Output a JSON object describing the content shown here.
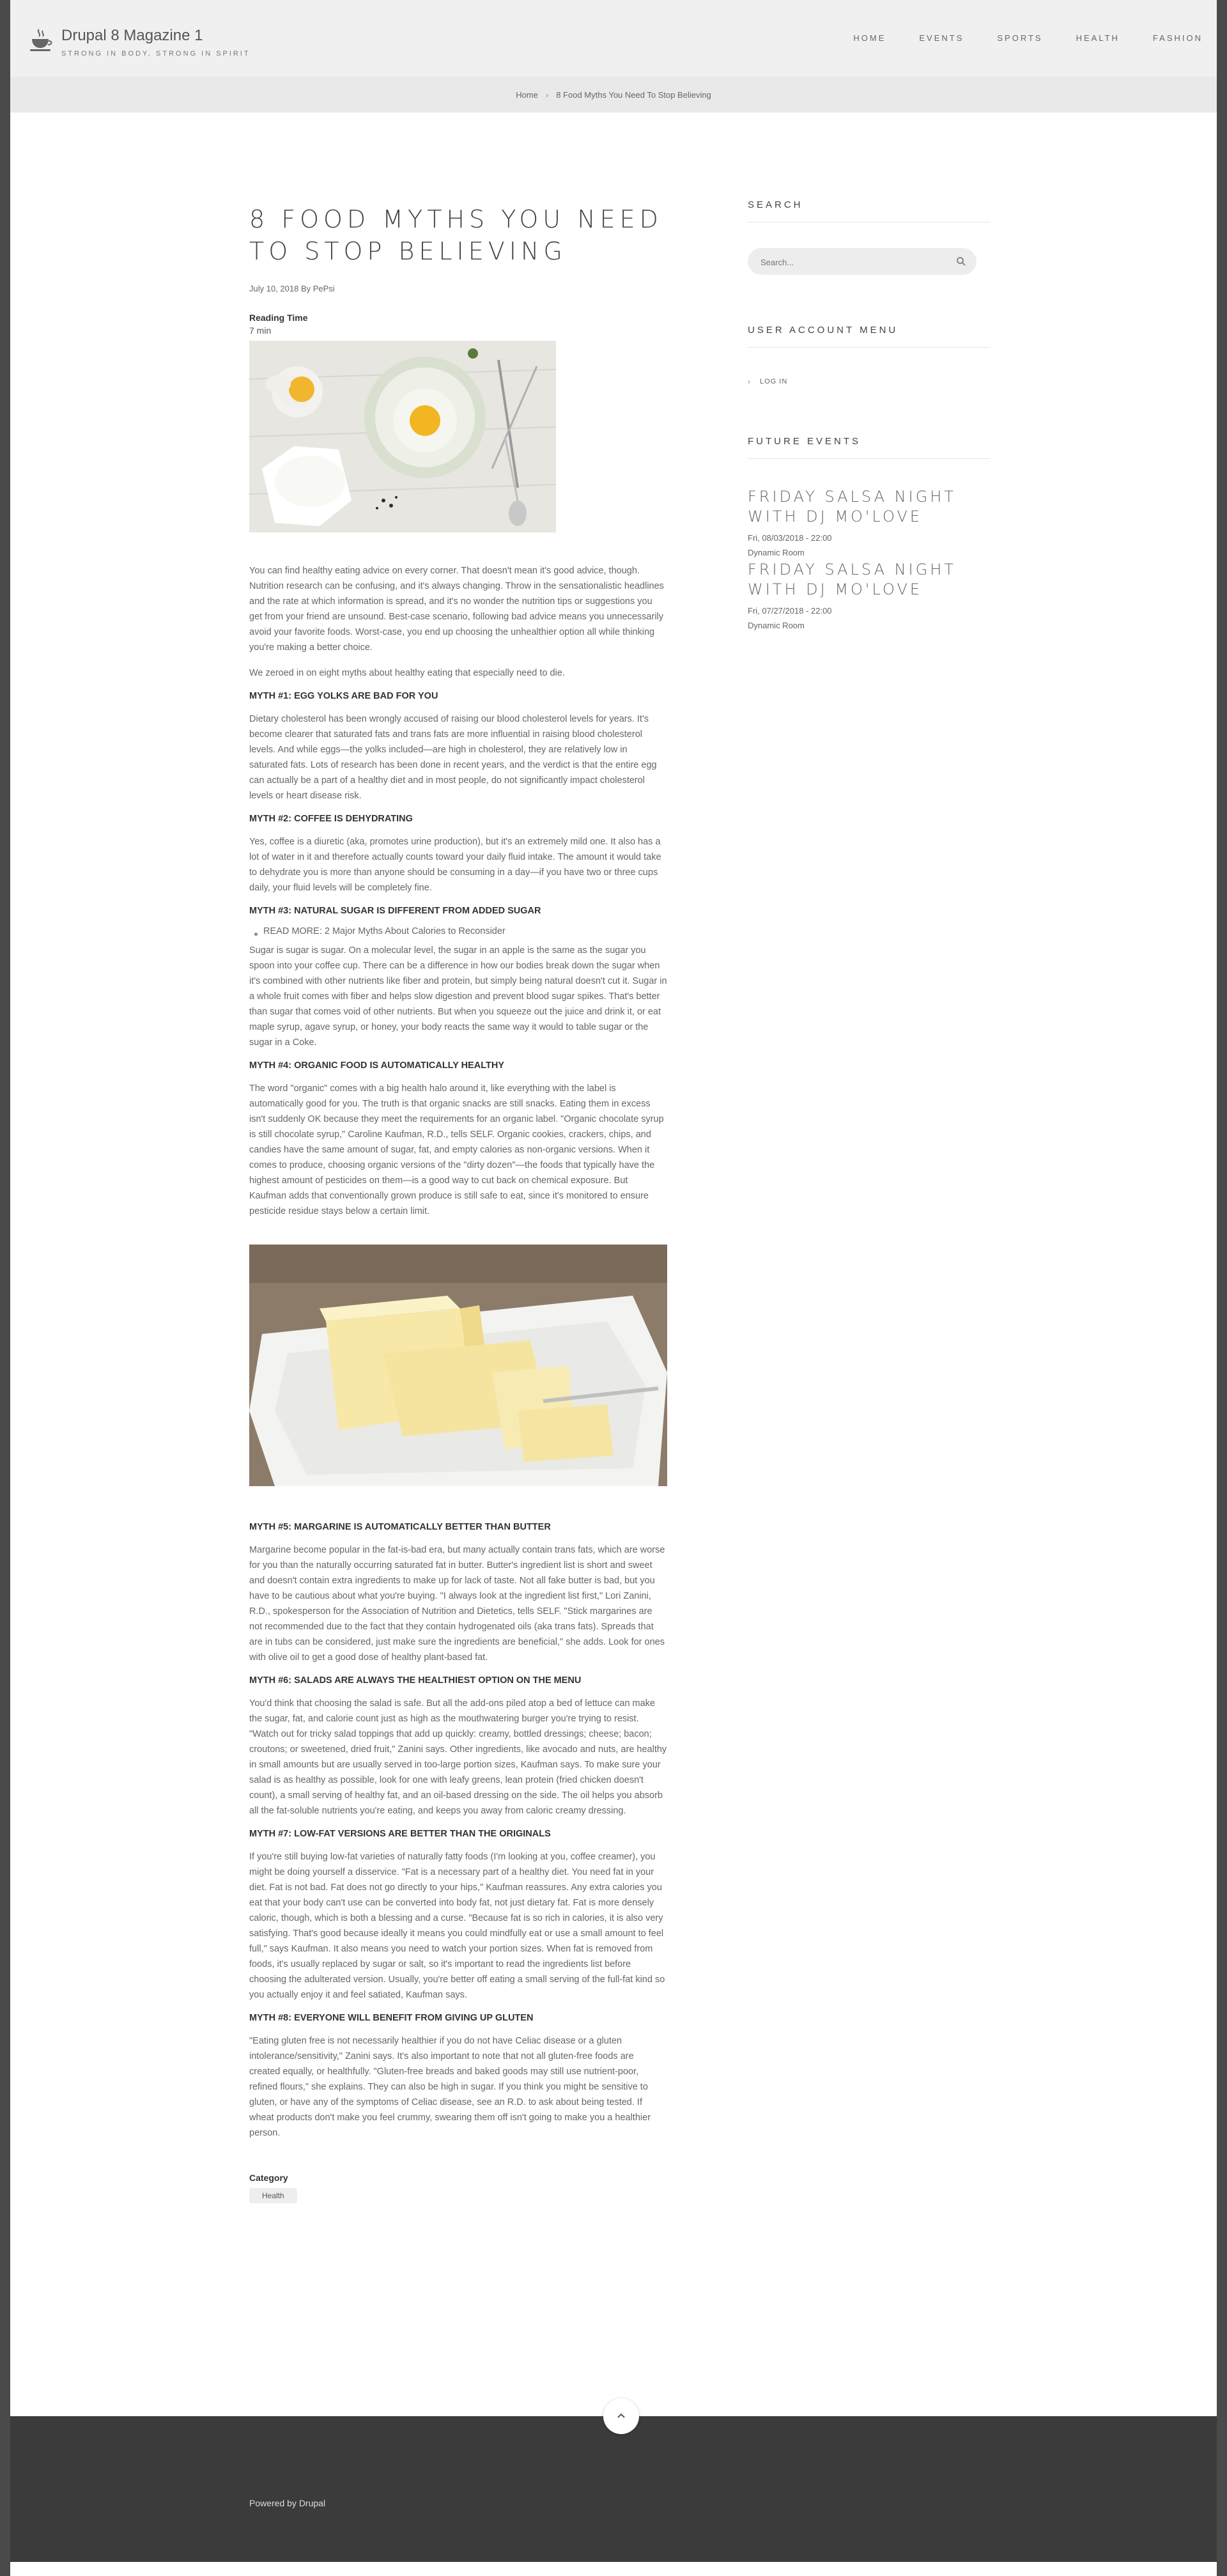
{
  "header": {
    "site_name": "Drupal 8 Magazine 1",
    "slogan": "STRONG IN BODY, STRONG IN SPIRIT",
    "nav": [
      "HOME",
      "EVENTS",
      "SPORTS",
      "HEALTH",
      "FASHION"
    ]
  },
  "breadcrumb": {
    "home": "Home",
    "current": "8 Food Myths You Need To Stop Believing"
  },
  "article": {
    "title": "8 FOOD MYTHS YOU NEED TO STOP BELIEVING",
    "meta": "July 10, 2018 By PePsi",
    "reading_time_label": "Reading Time",
    "reading_time_value": "7 min",
    "intro1": "You can find healthy eating advice on every corner. That doesn't mean it's good advice, though. Nutrition research can be confusing, and it's always changing. Throw in the sensationalistic headlines and the rate at which information is spread, and it's no wonder the nutrition tips or suggestions you get from your friend are unsound. Best-case scenario, following bad advice means you unnecessarily avoid your favorite foods. Worst-case, you end up choosing the unhealthier option all while thinking you're making a better choice.",
    "intro2": "We zeroed in on eight myths about healthy eating that especially need to die.",
    "myth1_title": "MYTH #1: EGG YOLKS ARE BAD FOR YOU",
    "myth1_text": "Dietary cholesterol has been wrongly accused of raising our blood cholesterol levels for years. It's become clearer that saturated fats and trans fats are more influential in raising blood cholesterol levels. And while eggs—the yolks included—are high in cholesterol, they are relatively low in saturated fats. Lots of research has been done in recent years, and the verdict is that the entire egg can actually be a part of a healthy diet and in most people, do not significantly impact cholesterol levels or heart disease risk.",
    "myth2_title": "MYTH #2: COFFEE IS DEHYDRATING",
    "myth2_text": "Yes, coffee is a diuretic (aka, promotes urine production), but it's an extremely mild one. It also has a lot of water in it and therefore actually counts toward your daily fluid intake. The amount it would take to dehydrate you is more than anyone should be consuming in a day—if you have two or three cups daily, your fluid levels will be completely fine.",
    "myth3_title": "MYTH #3: NATURAL SUGAR IS DIFFERENT FROM ADDED SUGAR",
    "myth3_readmore": "READ MORE: 2 Major Myths About Calories to Reconsider",
    "myth3_text": "Sugar is sugar is sugar. On a molecular level, the sugar in an apple is the same as the sugar you spoon into your coffee cup. There can be a difference in how our bodies break down the sugar when it's combined with other nutrients like fiber and protein, but simply being natural doesn't cut it. Sugar in a whole fruit comes with fiber and helps slow digestion and prevent blood sugar spikes. That's better than sugar that comes void of other nutrients. But when you squeeze out the juice and drink it, or eat maple syrup, agave syrup, or honey, your body reacts the same way it would to table sugar or the sugar in a Coke.",
    "myth4_title": "MYTH #4: ORGANIC FOOD IS AUTOMATICALLY HEALTHY",
    "myth4_text": "The word \"organic\" comes with a big health halo around it, like everything with the label is automatically good for you. The truth is that organic snacks are still snacks. Eating them in excess isn't suddenly OK because they meet the requirements for an organic label. \"Organic chocolate syrup is still chocolate syrup,\" Caroline Kaufman, R.D., tells SELF. Organic cookies, crackers, chips, and candies have the same amount of sugar, fat, and empty calories as non-organic versions. When it comes to produce, choosing organic versions of the \"dirty dozen\"—the foods that typically have the highest amount of pesticides on them—is a good way to cut back on chemical exposure. But Kaufman adds that conventionally grown produce is still safe to eat, since it's monitored to ensure pesticide residue stays below a certain limit.",
    "myth5_title": "MYTH #5: MARGARINE IS AUTOMATICALLY BETTER THAN BUTTER",
    "myth5_text": "Margarine become popular in the fat-is-bad era, but many actually contain trans fats, which are worse for you than the naturally occurring saturated fat in butter. Butter's ingredient list is short and sweet and doesn't contain extra ingredients to make up for lack of taste. Not all fake butter is bad, but you have to be cautious about what you're buying. \"I always look at the ingredient list first,\" Lori Zanini, R.D., spokesperson for the Association of Nutrition and Dietetics, tells SELF. \"Stick margarines are not recommended due to the fact that they contain hydrogenated oils (aka trans fats). Spreads that are in tubs can be considered, just make sure the ingredients are beneficial,\" she adds. Look for ones with olive oil to get a good dose of healthy plant-based fat.",
    "myth6_title": "MYTH #6: SALADS ARE ALWAYS THE HEALTHIEST OPTION ON THE MENU",
    "myth6_text": "You'd think that choosing the salad is safe. But all the add-ons piled atop a bed of lettuce can make the sugar, fat, and calorie count just as high as the mouthwatering burger you're trying to resist. \"Watch out for tricky salad toppings that add up quickly: creamy, bottled dressings; cheese; bacon; croutons; or sweetened, dried fruit,\" Zanini says. Other ingredients, like avocado and nuts, are healthy in small amounts but are usually served in too-large portion sizes, Kaufman says. To make sure your salad is as healthy as possible, look for one with leafy greens, lean protein (fried chicken doesn't count), a small serving of healthy fat, and an oil-based dressing on the side. The oil helps you absorb all the fat-soluble nutrients you're eating, and keeps you away from caloric creamy dressing.",
    "myth7_title": "MYTH #7: LOW-FAT VERSIONS ARE BETTER THAN THE ORIGINALS",
    "myth7_text": "If you're still buying low-fat varieties of naturally fatty foods (I'm looking at you, coffee creamer), you might be doing yourself a disservice. \"Fat is a necessary part of a healthy diet. You need fat in your diet. Fat is not bad. Fat does not go directly to your hips,\" Kaufman reassures. Any extra calories you eat that your body can't use can be converted into body fat, not just dietary fat. Fat is more densely caloric, though, which is both a blessing and a curse. \"Because fat is so rich in calories, it is also very satisfying. That's good because ideally it means you could mindfully eat or use a small amount to feel full,\" says Kaufman. It also means you need to watch your portion sizes. When fat is removed from foods, it's usually replaced by sugar or salt, so it's important to read the ingredients list before choosing the adulterated version. Usually, you're better off eating a small serving of the full-fat kind so you actually enjoy it and feel satiated, Kaufman says.",
    "myth8_title": "MYTH #8: EVERYONE WILL BENEFIT FROM GIVING UP GLUTEN",
    "myth8_text": "\"Eating gluten free is not necessarily healthier if you do not have Celiac disease or a gluten intolerance/sensitivity,\" Zanini says. It's also important to note that not all gluten-free foods are created equally, or healthfully. \"Gluten-free breads and baked goods may still use nutrient-poor, refined flours,\" she explains. They can also be high in sugar. If you think you might be sensitive to gluten, or have any of the symptoms of Celiac disease, see an R.D. to ask about being tested. If wheat products don't make you feel crummy, swearing them off isn't going to make you a healthier person.",
    "category_label": "Category",
    "category_value": "Health"
  },
  "sidebar": {
    "search_title": "SEARCH",
    "search_placeholder": "Search...",
    "account_title": "USER ACCOUNT MENU",
    "login_label": "LOG IN",
    "events_title": "FUTURE EVENTS",
    "events": [
      {
        "title": "FRIDAY SALSA NIGHT WITH DJ MO'LOVE",
        "date": "Fri, 08/03/2018 - 22:00",
        "room": "Dynamic Room"
      },
      {
        "title": "FRIDAY SALSA NIGHT WITH DJ MO'LOVE",
        "date": "Fri, 07/27/2018 - 22:00",
        "room": "Dynamic Room"
      }
    ]
  },
  "footer": {
    "text": "Powered by Drupal"
  }
}
